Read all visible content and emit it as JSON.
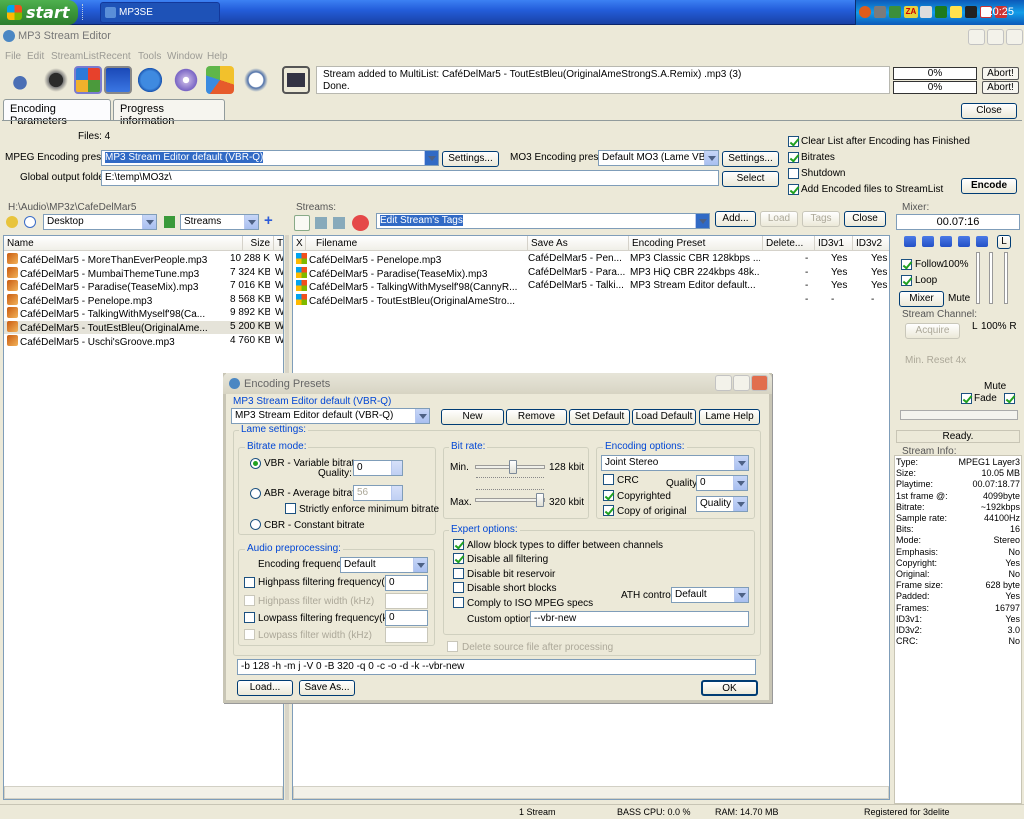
{
  "taskbar": {
    "start_label": "start",
    "task_label": "MP3SE",
    "clock": "20:25",
    "tray_text": "ZA"
  },
  "window": {
    "title": "MP3 Stream Editor",
    "menu": [
      "File",
      "Edit",
      "StreamList",
      "Recent",
      "Tools",
      "Window",
      "Help"
    ]
  },
  "status": {
    "line1": "Stream added to MultiList: CaféDelMar5 - ToutEstBleu(OriginalAmeStrongS.A.Remix) .mp3 (3)",
    "line2": "Done.",
    "progress1": "0%",
    "progress2": "0%",
    "abort1": "Abort!",
    "abort2": "Abort!"
  },
  "tabs": [
    "Encoding Parameters",
    "Progress information"
  ],
  "close_label": "Close",
  "encoding": {
    "files_label": "Files: 4",
    "mpeg_preset_label": "MPEG Encoding preset:",
    "mpeg_preset_value": "MP3 Stream Editor default (VBR-Q)",
    "settings_label": "Settings...",
    "mo3_preset_label": "MO3 Encoding preset:",
    "mo3_preset_value": "Default MO3 (Lame VBR-HQ)",
    "settings2_label": "Settings...",
    "output_label": "Global output folder:",
    "output_value": "E:\\temp\\MO3z\\",
    "select_label": "Select",
    "opt_clear": "Clear List after Encoding has Finished",
    "opt_bitrates": "Bitrates",
    "opt_shutdown": "Shutdown",
    "opt_add": "Add Encoded files to StreamList",
    "encode_label": "Encode"
  },
  "explorer": {
    "path": "H:\\Audio\\MP3z\\CafeDelMar5",
    "location": "Desktop",
    "filter": "Streams",
    "columns": [
      "Name",
      "Size",
      "T"
    ],
    "files": [
      {
        "name": "CaféDelMar5 - MoreThanEverPeople.mp3",
        "size": "10 288 KB",
        "t": "W"
      },
      {
        "name": "CaféDelMar5 - MumbaiThemeTune.mp3",
        "size": "7 324 KB",
        "t": "W"
      },
      {
        "name": "CaféDelMar5 - Paradise(TeaseMix).mp3",
        "size": "7 016 KB",
        "t": "W"
      },
      {
        "name": "CaféDelMar5 - Penelope.mp3",
        "size": "8 568 KB",
        "t": "W"
      },
      {
        "name": "CaféDelMar5 - TalkingWithMyself'98(Ca...",
        "size": "9 892 KB",
        "t": "W"
      },
      {
        "name": "CaféDelMar5 - ToutEstBleu(OriginalAme...",
        "size": "5 200 KB",
        "t": "W"
      },
      {
        "name": "CaféDelMar5 - Uschi'sGroove.mp3",
        "size": "4 760 KB",
        "t": "W"
      }
    ]
  },
  "streams": {
    "header": "Streams:",
    "tag_action": "Edit Stream's Tags",
    "add_label": "Add...",
    "load_label": "Load",
    "tags_label": "Tags",
    "close_label": "Close",
    "columns": [
      "X",
      "Filename",
      "Save As",
      "Encoding Preset",
      "Delete...",
      "ID3v1",
      "ID3v2"
    ],
    "rows": [
      {
        "filename": "CaféDelMar5 - Penelope.mp3",
        "saveas": "CaféDelMar5 - Pen...",
        "preset": "MP3 Classic CBR 128kbps ...",
        "del": "-",
        "id3v1": "Yes",
        "id3v2": "Yes"
      },
      {
        "filename": "CaféDelMar5 - Paradise(TeaseMix).mp3",
        "saveas": "CaféDelMar5 - Para...",
        "preset": "MP3 HiQ CBR 224kbps 48k...",
        "del": "-",
        "id3v1": "Yes",
        "id3v2": "Yes"
      },
      {
        "filename": "CaféDelMar5 - TalkingWithMyself'98(CannyR...",
        "saveas": "CaféDelMar5 - Talki...",
        "preset": "MP3 Stream Editor default...",
        "del": "-",
        "id3v1": "Yes",
        "id3v2": "Yes"
      },
      {
        "filename": "CaféDelMar5 - ToutEstBleu(OriginalAmeStro...",
        "saveas": "",
        "preset": "",
        "del": "-",
        "id3v1": "-",
        "id3v2": "-"
      }
    ]
  },
  "mixer": {
    "header": "Mixer:",
    "time": "00.07:16",
    "l_button": "L",
    "follow_label": "Follow",
    "follow_pct": "100%",
    "loop_label": "Loop",
    "mixer_label": "Mixer",
    "mute_label": "Mute",
    "stream_channel": "Stream Channel:",
    "acquire_label": "Acquire",
    "l_label": "L",
    "pct_r": "100% R",
    "min_reset": "Min. Reset 4x",
    "mute2": "Mute",
    "fade_label": "Fade",
    "ready": "Ready."
  },
  "stream_info": {
    "header": "Stream Info:",
    "rows": [
      {
        "k": "Type:",
        "v": "MPEG1 Layer3"
      },
      {
        "k": "Size:",
        "v": "10.05 MB"
      },
      {
        "k": "Playtime:",
        "v": "00.07:18.77"
      },
      {
        "k": "1st frame @:",
        "v": "4099byte"
      },
      {
        "k": "Bitrate:",
        "v": "~192kbps"
      },
      {
        "k": "Sample rate:",
        "v": "44100Hz"
      },
      {
        "k": "Bits:",
        "v": "16"
      },
      {
        "k": "Mode:",
        "v": "Stereo"
      },
      {
        "k": "Emphasis:",
        "v": "No"
      },
      {
        "k": "Copyright:",
        "v": "Yes"
      },
      {
        "k": "Original:",
        "v": "No"
      },
      {
        "k": "Frame size:",
        "v": "628 byte"
      },
      {
        "k": "Padded:",
        "v": "Yes"
      },
      {
        "k": "Frames:",
        "v": "16797"
      },
      {
        "k": "ID3v1:",
        "v": "Yes"
      },
      {
        "k": "ID3v2:",
        "v": "3.0"
      },
      {
        "k": "CRC:",
        "v": "No"
      }
    ]
  },
  "dialog": {
    "title": "Encoding Presets",
    "preset_title": "MP3 Stream Editor default (VBR-Q)",
    "preset_value": "MP3 Stream Editor default (VBR-Q)",
    "new_label": "New",
    "remove_label": "Remove",
    "setdefault_label": "Set Default",
    "loaddefault_label": "Load Default",
    "lamehelp_label": "Lame Help",
    "lame_settings": "Lame settings:",
    "bitrate_mode": "Bitrate mode:",
    "vbr_label": "VBR - Variable bitrate",
    "quality_label": "Quality:",
    "quality_value": "0",
    "abr_label": "ABR - Average bitrate",
    "abr_value": "56",
    "strict_label": "Strictly enforce minimum bitrate",
    "cbr_label": "CBR - Constant bitrate",
    "bit_rate": "Bit rate:",
    "min_label": "Min.",
    "min_value": "128 kbit",
    "max_label": "Max.",
    "max_value": "320 kbit",
    "min_level": 0.55,
    "max_level": 0.98,
    "enc_options": "Encoding options:",
    "channel_mode": "Joint Stereo",
    "crc_label": "CRC",
    "quality2_label": "Quality:",
    "quality2_value": "0",
    "copyrighted_label": "Copyrighted",
    "quality_dd": "Quality",
    "copyorig_label": "Copy of original",
    "audio_pre": "Audio preprocessing:",
    "enc_freq_label": "Encoding frequency:",
    "enc_freq_value": "Default",
    "highpass_label": "Highpass filtering frequency(kHz)",
    "highpass_value": "0",
    "highpass_width": "Highpass filter width (kHz)",
    "lowpass_label": "Lowpass filtering frequency(kHz)",
    "lowpass_value": "0",
    "lowpass_width": "Lowpass filter width (kHz)",
    "expert": "Expert options:",
    "opt_blocktypes": "Allow block types to differ between channels",
    "opt_disable_filter": "Disable all filtering",
    "opt_disable_res": "Disable bit reservoir",
    "opt_disable_short": "Disable short blocks",
    "opt_iso": "Comply to ISO MPEG specs",
    "ath_label": "ATH control:",
    "ath_value": "Default",
    "custom_label": "Custom options:",
    "custom_value": "--vbr-new",
    "delete_source": "Delete source file after processing",
    "cmdline": "-b 128 -h -m j -V 0 -B 320 -q 0 -c -o -d -k --vbr-new",
    "load_label": "Load...",
    "saveas_label": "Save As...",
    "ok_label": "OK"
  },
  "statusbar": {
    "streams": "1 Stream",
    "cpu": "BASS CPU: 0.0 %",
    "ram": "RAM: 14.70 MB",
    "reg": "Registered for 3delite"
  }
}
